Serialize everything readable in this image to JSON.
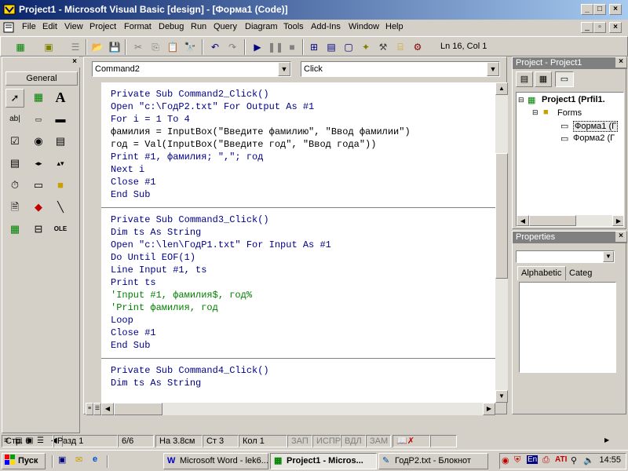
{
  "window": {
    "title": "Project1 - Microsoft Visual Basic [design] - [Форма1 (Code)]",
    "minimize": "_",
    "maximize": "□",
    "close": "×"
  },
  "menu": {
    "items": [
      "File",
      "Edit",
      "View",
      "Project",
      "Format",
      "Debug",
      "Run",
      "Query",
      "Diagram",
      "Tools",
      "Add-Ins",
      "Window",
      "Help"
    ]
  },
  "toolbar": {
    "position": "Ln 16, Col 1"
  },
  "toolbox": {
    "tab": "General"
  },
  "code": {
    "object_combo": "Command2",
    "proc_combo": "Click",
    "lines": [
      {
        "t": "Private Sub Command2_Click()",
        "k": "kw"
      },
      {
        "t": "Open \"c:\\ГодР2.txt\" For Output As #1",
        "k": "kw"
      },
      {
        "t": "For i = 1 To 4",
        "k": "kw"
      },
      {
        "t": "фамилия = InputBox(\"Введите фамилию\", \"Ввод фамилии\")",
        "k": ""
      },
      {
        "t": "год = Val(InputBox(\"Введите год\", \"Ввод года\"))",
        "k": ""
      },
      {
        "t": "Print #1, фамилия; \",\"; год",
        "k": "kw"
      },
      {
        "t": "Next i",
        "k": "kw"
      },
      {
        "t": "Close #1",
        "k": "kw"
      },
      {
        "t": "End Sub",
        "k": "kw"
      },
      {
        "t": "",
        "k": "sep"
      },
      {
        "t": "Private Sub Command3_Click()",
        "k": "kw"
      },
      {
        "t": "Dim ts As String",
        "k": "kw"
      },
      {
        "t": "Open \"c:\\len\\ГодР1.txt\" For Input As #1",
        "k": "kw"
      },
      {
        "t": "Do Until EOF(1)",
        "k": "kw"
      },
      {
        "t": "Line Input #1, ts",
        "k": "kw"
      },
      {
        "t": "Print ts",
        "k": "kw"
      },
      {
        "t": "'Input #1, фамилия$, год%",
        "k": "cm"
      },
      {
        "t": "'Print фамилия, год",
        "k": "cm"
      },
      {
        "t": "Loop",
        "k": "kw"
      },
      {
        "t": "Close #1",
        "k": "kw"
      },
      {
        "t": "End Sub",
        "k": "kw"
      },
      {
        "t": "",
        "k": "sep"
      },
      {
        "t": "Private Sub Command4_Click()",
        "k": "kw"
      },
      {
        "t": "Dim ts As String",
        "k": "kw"
      }
    ]
  },
  "project_panel": {
    "title": "Project - Project1",
    "root": "Project1 (Prfil1.",
    "forms_folder": "Forms",
    "form1": "Форма1 (Г",
    "form2": "Форма2 (Г"
  },
  "properties_panel": {
    "title": "Properties",
    "tab_alpha": "Alphabetic",
    "tab_categ": "Categ"
  },
  "statusbar": {
    "page": "Стр. 6",
    "section": "Разд 1",
    "pages": "6/6",
    "at": "На 3.8см",
    "line": "Ст 3",
    "col": "Кол 1",
    "rec": "ЗАП",
    "trk": "ИСПР",
    "ext": "ВДЛ",
    "ovr": "ЗАМ"
  },
  "taskbar": {
    "start": "Пуск",
    "tasks": [
      "Microsoft Word - lek6...",
      "Project1 - Micros...",
      "ГодР2.txt - Блокнот"
    ],
    "tray_lang": "En",
    "clock": "14:55"
  },
  "colors": {
    "keyword": "#00008b",
    "comment": "#008000",
    "titlebar_start": "#0a246a",
    "titlebar_end": "#a6caf0"
  }
}
